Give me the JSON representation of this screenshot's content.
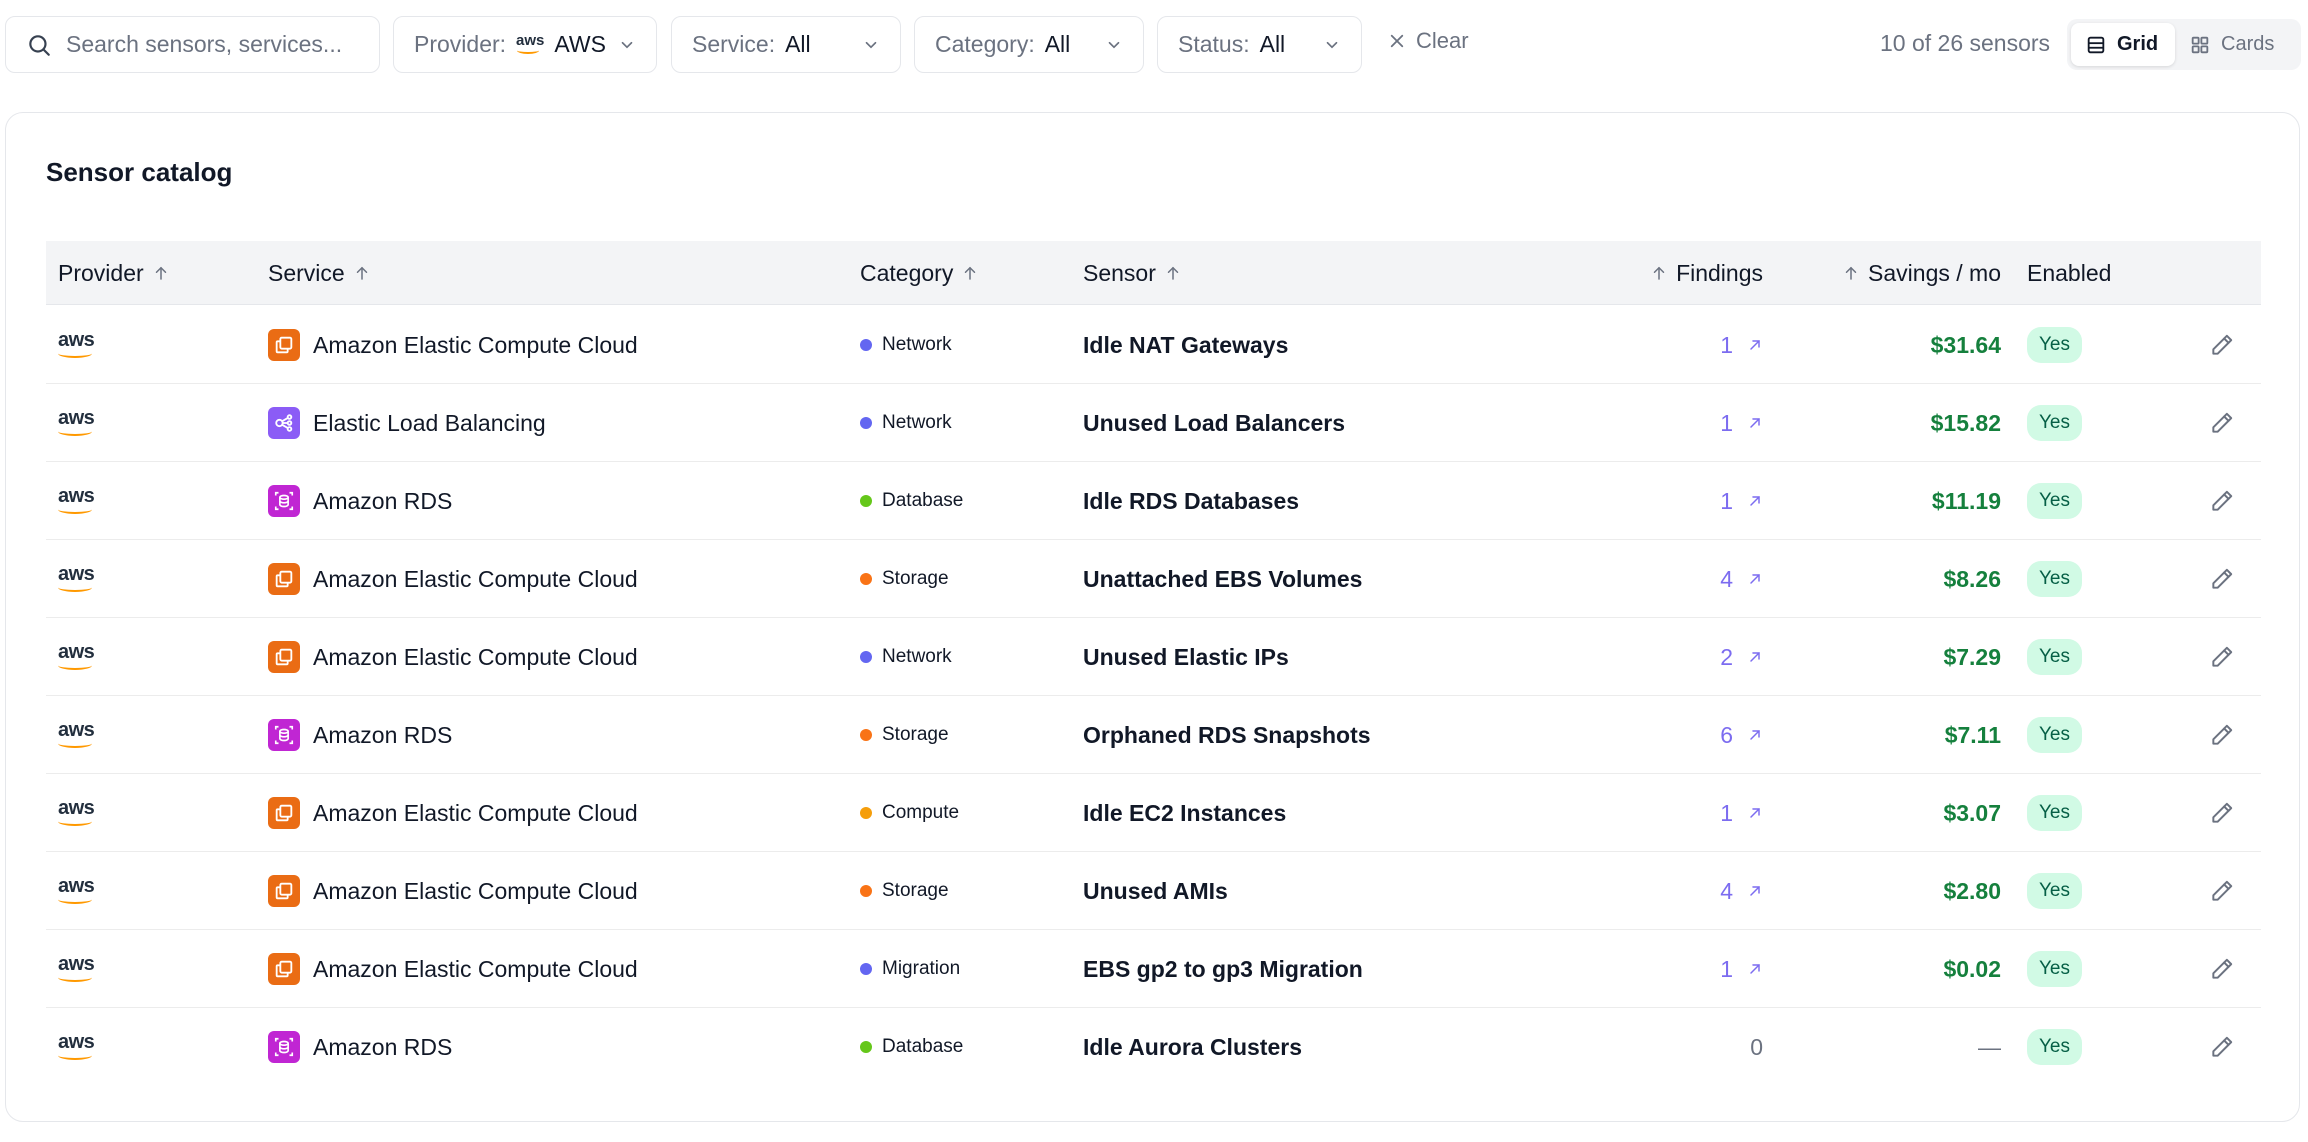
{
  "toolbar": {
    "search_placeholder": "Search sensors, services...",
    "provider": {
      "label": "Provider:",
      "value": "AWS",
      "logo_text": "aws"
    },
    "service": {
      "label": "Service:",
      "value": "All"
    },
    "category": {
      "label": "Category:",
      "value": "All"
    },
    "status": {
      "label": "Status:",
      "value": "All"
    },
    "clear_label": "Clear",
    "count_text": "10 of 26 sensors",
    "view_grid_label": "Grid",
    "view_cards_label": "Cards",
    "active_view": "Grid"
  },
  "catalog": {
    "title": "Sensor catalog",
    "columns": {
      "provider": "Provider",
      "service": "Service",
      "category": "Category",
      "sensor": "Sensor",
      "findings": "Findings",
      "savings": "Savings / mo",
      "enabled": "Enabled"
    },
    "rows": [
      {
        "provider": "aws",
        "service": "Amazon Elastic Compute Cloud",
        "service_icon": "ec2-icon",
        "service_color": "#ea6c14",
        "category": "Network",
        "category_color": "#6366f1",
        "sensor": "Idle NAT Gateways",
        "findings": "1",
        "savings": "$31.64",
        "enabled": "Yes"
      },
      {
        "provider": "aws",
        "service": "Elastic Load Balancing",
        "service_icon": "elb-icon",
        "service_color": "#8b5cf6",
        "category": "Network",
        "category_color": "#6366f1",
        "sensor": "Unused Load Balancers",
        "findings": "1",
        "savings": "$15.82",
        "enabled": "Yes"
      },
      {
        "provider": "aws",
        "service": "Amazon RDS",
        "service_icon": "rds-icon",
        "service_color": "#c026d3",
        "category": "Database",
        "category_color": "#65c71a",
        "sensor": "Idle RDS Databases",
        "findings": "1",
        "savings": "$11.19",
        "enabled": "Yes"
      },
      {
        "provider": "aws",
        "service": "Amazon Elastic Compute Cloud",
        "service_icon": "ec2-icon",
        "service_color": "#ea6c14",
        "category": "Storage",
        "category_color": "#f97316",
        "sensor": "Unattached EBS Volumes",
        "findings": "4",
        "savings": "$8.26",
        "enabled": "Yes"
      },
      {
        "provider": "aws",
        "service": "Amazon Elastic Compute Cloud",
        "service_icon": "ec2-icon",
        "service_color": "#ea6c14",
        "category": "Network",
        "category_color": "#6366f1",
        "sensor": "Unused Elastic IPs",
        "findings": "2",
        "savings": "$7.29",
        "enabled": "Yes"
      },
      {
        "provider": "aws",
        "service": "Amazon RDS",
        "service_icon": "rds-icon",
        "service_color": "#c026d3",
        "category": "Storage",
        "category_color": "#f97316",
        "sensor": "Orphaned RDS Snapshots",
        "findings": "6",
        "savings": "$7.11",
        "enabled": "Yes"
      },
      {
        "provider": "aws",
        "service": "Amazon Elastic Compute Cloud",
        "service_icon": "ec2-icon",
        "service_color": "#ea6c14",
        "category": "Compute",
        "category_color": "#f59e0b",
        "sensor": "Idle EC2 Instances",
        "findings": "1",
        "savings": "$3.07",
        "enabled": "Yes"
      },
      {
        "provider": "aws",
        "service": "Amazon Elastic Compute Cloud",
        "service_icon": "ec2-icon",
        "service_color": "#ea6c14",
        "category": "Storage",
        "category_color": "#f97316",
        "sensor": "Unused AMIs",
        "findings": "4",
        "savings": "$2.80",
        "enabled": "Yes"
      },
      {
        "provider": "aws",
        "service": "Amazon Elastic Compute Cloud",
        "service_icon": "ec2-icon",
        "service_color": "#ea6c14",
        "category": "Migration",
        "category_color": "#6366f1",
        "sensor": "EBS gp2 to gp3 Migration",
        "findings": "1",
        "savings": "$0.02",
        "enabled": "Yes"
      },
      {
        "provider": "aws",
        "service": "Amazon RDS",
        "service_icon": "rds-icon",
        "service_color": "#c026d3",
        "category": "Database",
        "category_color": "#65c71a",
        "sensor": "Idle Aurora Clusters",
        "findings": "0",
        "savings": "—",
        "enabled": "Yes"
      }
    ]
  }
}
